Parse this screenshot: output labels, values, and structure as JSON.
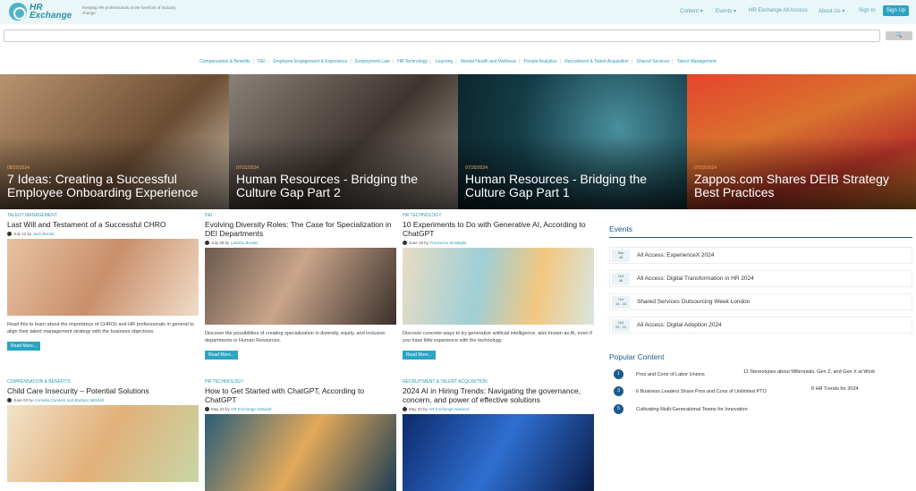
{
  "header": {
    "logo_line1": "HR",
    "logo_line2": "Exchange",
    "tagline": "Keeping HR professionals at the forefront of industry change",
    "nav": [
      "Content ▾",
      "Events ▾",
      "HR Exchange All Access",
      "About Us ▾",
      "Sign In"
    ],
    "signup_label": "Sign Up"
  },
  "search": {
    "placeholder": "",
    "button_label": "🔍"
  },
  "categories": [
    "Compensation & Benefits",
    "DEI",
    "Employee Engagement & Experience",
    "Employment Law",
    "HR Technology",
    "Learning",
    "Mental Health and Wellness",
    "People Analytics",
    "Recruitment & Talent Acquisition",
    "Shared Services",
    "Talent Management"
  ],
  "heroes": [
    {
      "date": "08/20/2024",
      "title": "7 Ideas: Creating a Successful Employee Onboarding Experience",
      "color": "#8c6b4f"
    },
    {
      "date": "07/31/2024",
      "title": "Human Resources - Bridging the Culture Gap Part 2",
      "color": "#5b5148"
    },
    {
      "date": "07/30/2024",
      "title": "Human Resources - Bridging the Culture Gap Part 1",
      "color": "#1f4b56"
    },
    {
      "date": "07/19/2024",
      "title": "Zappos.com Shares DEIB Strategy Best Practices",
      "color": "#c9572f"
    }
  ],
  "articles": [
    {
      "category": "Talent Management",
      "title": "Last Will and Testament of a Successful CHRO",
      "date": "July 12",
      "author": "Jack Bucalo",
      "desc": "Read this to learn about the importance of CHROs and HR professionals in general to align their talent management strategy with the business objectives.",
      "read_more": "Read More..."
    },
    {
      "category": "DEI",
      "title": "Evolving Diversity Roles: The Case for Specialization in DEI Departments",
      "date": "July 08",
      "author": "Lakisha Brooks",
      "desc": "Discover the possibilities of creating specialization in diversity, equity, and inclusion departments in Human Resources.",
      "read_more": "Read More..."
    },
    {
      "category": "HR Technology",
      "title": "10 Experiments to Do with Generative AI, According to ChatGPT",
      "date": "June 19",
      "author": "Francesca Di Meglio",
      "desc": "Discover concrete ways to try generative artificial intelligence, also known as AI, even if you have little experience with the technology.",
      "read_more": "Read More..."
    },
    {
      "category": "Compensation & Benefits",
      "title": "Child Care Insecurity – Potential Solutions",
      "date": "June 03",
      "author": "Cornelia Gamlem and Barbara Mitchell",
      "desc": "",
      "read_more": ""
    },
    {
      "category": "HR Technology",
      "title": "How to Get Started with ChatGPT, According to ChatGPT",
      "date": "May 23",
      "author": "HR Exchange Network",
      "desc": "",
      "read_more": ""
    },
    {
      "category": "Recruitment & Talent Acquisition",
      "title": "2024 AI in Hiring Trends: Navigating the governance, concern, and power of effective solutions",
      "date": "May 23",
      "author": "HR Exchange Network",
      "desc": "",
      "read_more": ""
    }
  ],
  "by_label": "by",
  "events": {
    "heading": "Events",
    "items": [
      {
        "month": "Sep",
        "days": "18",
        "name": "All Access: ExperienceX 2024"
      },
      {
        "month": "Oct",
        "days": "08",
        "name": "All Access: Digital Transformation in HR 2024"
      },
      {
        "month": "Oct",
        "days": "14 - 16",
        "name": "Shared Services Outsourcing Week London"
      },
      {
        "month": "Oct",
        "days": "22 - 23",
        "name": "All Access: Digital Adoption 2024"
      }
    ]
  },
  "popular": {
    "heading": "Popular Content",
    "items": [
      {
        "num": "1",
        "left": "Pros and Cons of Labor Unions",
        "right": "11 Stereotypes about Millennials, Gen Z, and Gen X at Work"
      },
      {
        "num": "3",
        "left": "6 Business Leaders Share Pros and Cons of Unlimited PTO",
        "right": "8 HR Trends for 2024"
      },
      {
        "num": "5",
        "left": "Cultivating Multi-Generational Teams for Innovation",
        "right": ""
      }
    ]
  }
}
